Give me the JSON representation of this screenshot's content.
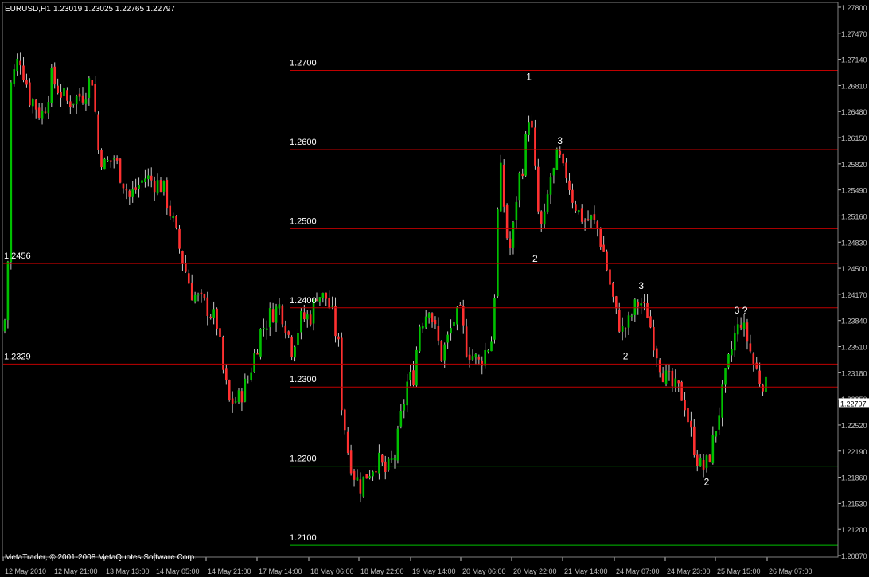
{
  "header": {
    "symbol": "EURUSD,H1",
    "ohlc": "1.23019 1.23025 1.22765 1.22797"
  },
  "footer": {
    "copyright": "MetaTrader, © 2001-2008 MetaQuotes Software Corp."
  },
  "colors": {
    "background": "#000000",
    "bull": "#00c000",
    "bear": "#ff3030",
    "wick": "#c8c8c8",
    "level_red": "#c00000",
    "level_green": "#00c000",
    "axis": "#c0c0c0",
    "text": "#ffffff"
  },
  "chart_data": {
    "type": "candlestick",
    "timeframe": "H1",
    "ylim": [
      1.2085,
      1.2785
    ],
    "y_ticks": [
      "1.27800",
      "1.27470",
      "1.27140",
      "1.26810",
      "1.26480",
      "1.26150",
      "1.25820",
      "1.25490",
      "1.25160",
      "1.24830",
      "1.24500",
      "1.24170",
      "1.23840",
      "1.23510",
      "1.23180",
      "1.22850",
      "1.22520",
      "1.22190",
      "1.21860",
      "1.21530",
      "1.21200",
      "1.20870"
    ],
    "x_ticks": [
      "12 May 2010",
      "12 May 21:00",
      "13 May 13:00",
      "14 May 05:00",
      "14 May 21:00",
      "17 May 14:00",
      "18 May 06:00",
      "18 May 22:00",
      "19 May 14:00",
      "20 May 06:00",
      "20 May 22:00",
      "21 May 14:00",
      "24 May 07:00",
      "24 May 23:00",
      "25 May 15:00",
      "26 May 07:00"
    ],
    "current_price": "1.22797",
    "price_path": [
      [
        0,
        1.237,
        1.24
      ],
      [
        1,
        1.245,
        1.247
      ],
      [
        2,
        1.266,
        1.27
      ],
      [
        5,
        1.2705,
        1.2735
      ],
      [
        8,
        1.2655,
        1.268
      ],
      [
        12,
        1.263,
        1.266
      ],
      [
        15,
        1.268,
        1.27
      ],
      [
        20,
        1.265,
        1.267
      ],
      [
        25,
        1.266,
        1.268
      ],
      [
        28,
        1.268,
        1.2705
      ],
      [
        30,
        1.259,
        1.261
      ],
      [
        32,
        1.257,
        1.259
      ],
      [
        35,
        1.258,
        1.26
      ],
      [
        40,
        1.253,
        1.255
      ],
      [
        45,
        1.2555,
        1.2575
      ],
      [
        50,
        1.2545,
        1.2565
      ],
      [
        52,
        1.2525,
        1.255
      ],
      [
        55,
        1.248,
        1.25
      ],
      [
        57,
        1.245,
        1.247
      ],
      [
        60,
        1.241,
        1.243
      ],
      [
        62,
        1.24,
        1.242
      ],
      [
        65,
        1.239,
        1.241
      ],
      [
        68,
        1.237,
        1.239
      ],
      [
        70,
        1.231,
        1.233
      ],
      [
        72,
        1.227,
        1.229
      ],
      [
        75,
        1.2275,
        1.2295
      ],
      [
        78,
        1.23,
        1.232
      ],
      [
        80,
        1.233,
        1.235
      ],
      [
        82,
        1.236,
        1.238
      ],
      [
        85,
        1.238,
        1.24
      ],
      [
        88,
        1.2395,
        1.241
      ],
      [
        90,
        1.237,
        1.239
      ],
      [
        92,
        1.234,
        1.236
      ],
      [
        95,
        1.2375,
        1.2395
      ],
      [
        98,
        1.238,
        1.24
      ],
      [
        100,
        1.241,
        1.2425
      ],
      [
        103,
        1.2405,
        1.242
      ],
      [
        105,
        1.238,
        1.24
      ],
      [
        107,
        1.234,
        1.236
      ],
      [
        108,
        1.227,
        1.229
      ],
      [
        110,
        1.221,
        1.223
      ],
      [
        112,
        1.218,
        1.22
      ],
      [
        114,
        1.2165,
        1.2185
      ],
      [
        116,
        1.218,
        1.22
      ],
      [
        118,
        1.219,
        1.221
      ],
      [
        120,
        1.22,
        1.2215
      ],
      [
        122,
        1.2185,
        1.22
      ],
      [
        125,
        1.2205,
        1.222
      ],
      [
        127,
        1.225,
        1.227
      ],
      [
        129,
        1.2295,
        1.2315
      ],
      [
        131,
        1.2305,
        1.2325
      ],
      [
        133,
        1.237,
        1.239
      ],
      [
        135,
        1.2385,
        1.24
      ],
      [
        136,
        1.2395,
        1.241
      ],
      [
        138,
        1.236,
        1.238
      ],
      [
        140,
        1.233,
        1.235
      ],
      [
        142,
        1.235,
        1.237
      ],
      [
        144,
        1.2375,
        1.2395
      ],
      [
        146,
        1.238,
        1.24
      ],
      [
        148,
        1.234,
        1.236
      ],
      [
        150,
        1.233,
        1.235
      ],
      [
        152,
        1.232,
        1.234
      ],
      [
        154,
        1.2335,
        1.2355
      ],
      [
        156,
        1.235,
        1.237
      ],
      [
        157,
        1.241,
        1.243
      ],
      [
        158,
        1.251,
        1.253
      ],
      [
        159,
        1.256,
        1.258
      ],
      [
        160,
        1.252,
        1.254
      ],
      [
        161,
        1.248,
        1.25
      ],
      [
        162,
        1.2465,
        1.2485
      ],
      [
        163,
        1.249,
        1.251
      ],
      [
        164,
        1.253,
        1.255
      ],
      [
        165,
        1.2555,
        1.2575
      ],
      [
        166,
        1.257,
        1.259
      ],
      [
        167,
        1.26,
        1.262
      ],
      [
        168,
        1.2635,
        1.266
      ],
      [
        169,
        1.261,
        1.263
      ],
      [
        170,
        1.256,
        1.258
      ],
      [
        171,
        1.251,
        1.253
      ],
      [
        172,
        1.249,
        1.251
      ],
      [
        173,
        1.25,
        1.252
      ],
      [
        174,
        1.253,
        1.255
      ],
      [
        175,
        1.2555,
        1.2575
      ],
      [
        176,
        1.256,
        1.258
      ],
      [
        177,
        1.258,
        1.2598
      ],
      [
        178,
        1.2575,
        1.2595
      ],
      [
        179,
        1.256,
        1.258
      ],
      [
        180,
        1.256,
        1.2578
      ],
      [
        182,
        1.253,
        1.255
      ],
      [
        184,
        1.251,
        1.253
      ],
      [
        186,
        1.25,
        1.252
      ],
      [
        188,
        1.2505,
        1.252
      ],
      [
        190,
        1.249,
        1.251
      ],
      [
        192,
        1.246,
        1.248
      ],
      [
        194,
        1.242,
        1.244
      ],
      [
        196,
        1.238,
        1.24
      ],
      [
        198,
        1.236,
        1.238
      ],
      [
        200,
        1.237,
        1.239
      ],
      [
        202,
        1.2395,
        1.241
      ],
      [
        204,
        1.24,
        1.2412
      ],
      [
        206,
        1.2385,
        1.24
      ],
      [
        208,
        1.235,
        1.237
      ],
      [
        210,
        1.232,
        1.234
      ],
      [
        212,
        1.23,
        1.232
      ],
      [
        214,
        1.229,
        1.231
      ],
      [
        216,
        1.229,
        1.2305
      ],
      [
        218,
        1.227,
        1.229
      ],
      [
        220,
        1.223,
        1.225
      ],
      [
        222,
        1.22,
        1.2215
      ],
      [
        224,
        1.219,
        1.2205
      ],
      [
        226,
        1.2205,
        1.222
      ],
      [
        228,
        1.224,
        1.226
      ],
      [
        230,
        1.228,
        1.23
      ],
      [
        232,
        1.232,
        1.234
      ],
      [
        234,
        1.2355,
        1.2375
      ],
      [
        236,
        1.2375,
        1.239
      ],
      [
        238,
        1.235,
        1.237
      ],
      [
        240,
        1.232,
        1.234
      ],
      [
        242,
        1.23,
        1.232
      ],
      [
        244,
        1.2295,
        1.231
      ],
      [
        246,
        1.2285,
        1.23
      ],
      [
        248,
        1.228,
        1.2297
      ]
    ],
    "horizontal_levels": [
      {
        "price": "1.2700",
        "color": "red",
        "label": "1.2700",
        "label_at": "middle"
      },
      {
        "price": "1.2600",
        "color": "red",
        "label": "1.2600",
        "label_at": "middle"
      },
      {
        "price": "1.2500",
        "color": "red",
        "label": "1.2500",
        "label_at": "middle"
      },
      {
        "price": "1.2456",
        "color": "red",
        "label": "1.2456",
        "label_at": "left"
      },
      {
        "price": "1.2400",
        "color": "red",
        "label": "1.2400",
        "label_at": "middle"
      },
      {
        "price": "1.2329",
        "color": "red",
        "label": "1.2329",
        "label_at": "left"
      },
      {
        "price": "1.2300",
        "color": "red",
        "label": "1.2300",
        "label_at": "middle"
      },
      {
        "price": "1.2200",
        "color": "green",
        "label": "1.2200",
        "label_at": "middle"
      },
      {
        "price": "1.2100",
        "color": "green",
        "label": "1.2100",
        "label_at": "middle"
      }
    ],
    "wave_annotations": [
      {
        "text": "1",
        "price": 1.2688,
        "bar": 168
      },
      {
        "text": "3",
        "price": 1.2607,
        "bar": 178
      },
      {
        "text": "2",
        "price": 1.2458,
        "bar": 170
      },
      {
        "text": "3",
        "price": 1.2424,
        "bar": 204
      },
      {
        "text": "2",
        "price": 1.2335,
        "bar": 199
      },
      {
        "text": "3 ?",
        "price": 1.2393,
        "bar": 236
      },
      {
        "text": "2",
        "price": 1.2176,
        "bar": 225
      }
    ]
  }
}
